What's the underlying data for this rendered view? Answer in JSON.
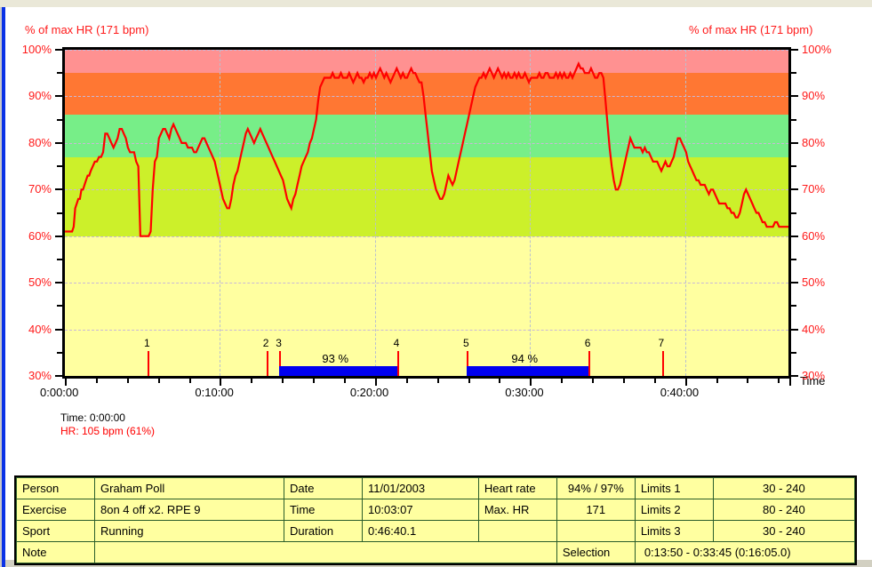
{
  "chart_data": {
    "type": "line",
    "title": "% of max HR (171 bpm)",
    "title_right": "% of max HR (171 bpm)",
    "xlabel": "Time",
    "ylabel": "% of max HR (171 bpm)",
    "ylim": [
      30,
      100
    ],
    "xlim": [
      0,
      2800
    ],
    "grid": true,
    "y_ticks": [
      "30%",
      "40%",
      "50%",
      "60%",
      "70%",
      "80%",
      "90%",
      "100%"
    ],
    "y_tick_values": [
      30,
      40,
      50,
      60,
      70,
      80,
      90,
      100
    ],
    "x_ticks": [
      "0:00:00",
      "0:10:00",
      "0:20:00",
      "0:30:00",
      "0:40:00"
    ],
    "x_tick_seconds": [
      0,
      600,
      1200,
      1800,
      2400
    ],
    "zones": [
      {
        "name": "zone-above-max",
        "from": 100,
        "to": 104,
        "color": "#e0e0e0"
      },
      {
        "name": "zone-5",
        "from": 95,
        "to": 100,
        "color": "#ff9191"
      },
      {
        "name": "zone-4",
        "from": 86,
        "to": 95,
        "color": "#ff7733"
      },
      {
        "name": "zone-3",
        "from": 77,
        "to": 86,
        "color": "#77ee88"
      },
      {
        "name": "zone-2",
        "from": 60,
        "to": 77,
        "color": "#ccf02a"
      },
      {
        "name": "zone-1",
        "from": 30,
        "to": 60,
        "color": "#ffffa0"
      }
    ],
    "series": [
      {
        "name": "Heart rate (% of max)",
        "color": "#ff0000",
        "x": [
          0,
          10,
          20,
          28,
          34,
          40,
          46,
          52,
          58,
          64,
          70,
          76,
          82,
          88,
          94,
          100,
          108,
          116,
          124,
          132,
          140,
          148,
          156,
          164,
          172,
          180,
          188,
          196,
          204,
          212,
          220,
          228,
          236,
          244,
          252,
          260,
          268,
          276,
          284,
          292,
          300,
          308,
          316,
          324,
          332,
          340,
          348,
          356,
          364,
          372,
          380,
          388,
          396,
          404,
          412,
          420,
          428,
          436,
          444,
          452,
          460,
          468,
          476,
          484,
          492,
          500,
          508,
          516,
          524,
          532,
          540,
          548,
          556,
          564,
          572,
          580,
          588,
          596,
          604,
          612,
          620,
          628,
          636,
          644,
          652,
          660,
          668,
          676,
          684,
          692,
          700,
          708,
          716,
          724,
          732,
          740,
          748,
          756,
          764,
          772,
          780,
          788,
          796,
          804,
          812,
          820,
          828,
          836,
          844,
          852,
          860,
          868,
          876,
          884,
          892,
          900,
          908,
          916,
          924,
          932,
          940,
          948,
          956,
          964,
          972,
          980,
          988,
          996,
          1004,
          1012,
          1020,
          1028,
          1036,
          1044,
          1052,
          1060,
          1068,
          1076,
          1084,
          1092,
          1100,
          1108,
          1116,
          1124,
          1132,
          1140,
          1148,
          1156,
          1164,
          1172,
          1180,
          1188,
          1196,
          1204,
          1212,
          1220,
          1228,
          1236,
          1244,
          1252,
          1260,
          1268,
          1276,
          1284,
          1292,
          1300,
          1308,
          1316,
          1324,
          1332,
          1340,
          1348,
          1356,
          1364,
          1372,
          1380,
          1388,
          1396,
          1404,
          1412,
          1420,
          1428,
          1436,
          1444,
          1452,
          1460,
          1468,
          1476,
          1484,
          1492,
          1500,
          1508,
          1516,
          1524,
          1532,
          1540,
          1548,
          1556,
          1564,
          1572,
          1580,
          1588,
          1596,
          1604,
          1612,
          1620,
          1628,
          1636,
          1644,
          1652,
          1660,
          1668,
          1676,
          1684,
          1692,
          1700,
          1708,
          1716,
          1724,
          1732,
          1740,
          1748,
          1756,
          1764,
          1772,
          1780,
          1788,
          1796,
          1804,
          1812,
          1820,
          1828,
          1836,
          1844,
          1852,
          1860,
          1868,
          1876,
          1884,
          1892,
          1900,
          1908,
          1916,
          1924,
          1932,
          1940,
          1948,
          1956,
          1964,
          1972,
          1980,
          1988,
          1996,
          2004,
          2012,
          2020,
          2028,
          2036,
          2044,
          2052,
          2060,
          2068,
          2076,
          2084,
          2092,
          2100,
          2108,
          2116,
          2124,
          2132,
          2140,
          2148,
          2156,
          2164,
          2172,
          2180,
          2188,
          2196,
          2204,
          2212,
          2220,
          2228,
          2236,
          2244,
          2252,
          2260,
          2268,
          2276,
          2284,
          2292,
          2300,
          2308,
          2316,
          2324,
          2332,
          2340,
          2348,
          2356,
          2364,
          2372,
          2380,
          2388,
          2396,
          2404,
          2412,
          2420,
          2428,
          2436,
          2444,
          2452,
          2460,
          2468,
          2476,
          2484,
          2492,
          2500,
          2508,
          2516,
          2524,
          2532,
          2540,
          2548,
          2556,
          2564,
          2572,
          2580,
          2588,
          2596,
          2604,
          2612,
          2620,
          2628,
          2636,
          2644,
          2652,
          2660,
          2668,
          2676,
          2684,
          2692,
          2700,
          2708,
          2716,
          2724,
          2732,
          2740,
          2748,
          2756,
          2764,
          2772,
          2780,
          2790,
          2800
        ],
        "y": [
          61,
          61,
          61,
          61,
          62,
          66,
          67,
          68,
          68,
          70,
          70,
          71,
          72,
          73,
          73,
          74,
          75,
          76,
          76,
          77,
          77,
          78,
          82,
          82,
          81,
          80,
          79,
          80,
          81,
          83,
          83,
          82,
          81,
          79,
          78,
          78,
          78,
          76,
          75,
          60,
          60,
          60,
          60,
          60,
          61,
          70,
          76,
          77,
          81,
          82,
          83,
          83,
          82,
          81,
          83,
          84,
          83,
          82,
          81,
          80,
          80,
          80,
          79,
          79,
          79,
          78,
          78,
          79,
          80,
          81,
          81,
          80,
          79,
          78,
          77,
          76,
          74,
          72,
          70,
          68,
          67,
          66,
          66,
          68,
          71,
          73,
          74,
          76,
          78,
          80,
          82,
          83,
          82,
          81,
          80,
          81,
          82,
          83,
          82,
          81,
          80,
          79,
          78,
          77,
          76,
          75,
          74,
          73,
          72,
          70,
          68,
          67,
          66,
          68,
          69,
          71,
          73,
          75,
          76,
          77,
          78,
          80,
          81,
          83,
          85,
          89,
          92,
          93,
          94,
          94,
          94,
          94,
          95,
          94,
          94,
          94,
          95,
          94,
          94,
          94,
          95,
          94,
          93,
          94,
          95,
          94,
          94,
          93,
          94,
          94,
          95,
          94,
          95,
          94,
          95,
          96,
          95,
          94,
          95,
          94,
          93,
          94,
          95,
          96,
          95,
          94,
          95,
          94,
          94,
          95,
          96,
          95,
          95,
          94,
          93,
          93,
          90,
          86,
          82,
          78,
          74,
          72,
          70,
          69,
          68,
          68,
          69,
          71,
          73,
          72,
          71,
          72,
          74,
          76,
          78,
          80,
          82,
          84,
          86,
          88,
          90,
          92,
          93,
          94,
          94,
          95,
          94,
          95,
          96,
          95,
          94,
          95,
          96,
          95,
          94,
          95,
          94,
          95,
          94,
          94,
          95,
          94,
          95,
          94,
          94,
          95,
          94,
          93,
          94,
          94,
          94,
          94,
          95,
          94,
          94,
          95,
          95,
          94,
          94,
          94,
          95,
          94,
          95,
          94,
          95,
          94,
          94,
          95,
          94,
          95,
          96,
          97,
          96,
          96,
          95,
          95,
          95,
          96,
          95,
          94,
          94,
          95,
          95,
          94,
          89,
          84,
          79,
          75,
          72,
          70,
          70,
          71,
          73,
          75,
          77,
          79,
          81,
          80,
          79,
          79,
          79,
          79,
          78,
          79,
          78,
          78,
          77,
          76,
          76,
          76,
          75,
          74,
          75,
          76,
          75,
          75,
          76,
          77,
          79,
          81,
          81,
          80,
          79,
          78,
          76,
          75,
          74,
          73,
          72,
          72,
          71,
          71,
          71,
          70,
          69,
          70,
          70,
          69,
          68,
          67,
          67,
          67,
          67,
          66,
          66,
          65,
          65,
          64,
          64,
          65,
          67,
          69,
          70,
          69,
          68,
          67,
          66,
          65,
          65,
          64,
          63,
          63,
          62,
          62,
          62,
          62,
          63,
          63,
          62,
          62,
          62,
          62,
          62,
          62,
          62,
          62,
          63,
          63,
          62,
          62,
          62,
          62
        ]
      }
    ],
    "lap_markers": [
      {
        "label": "1",
        "seconds": 320
      },
      {
        "label": "2",
        "seconds": 780
      },
      {
        "label": "3",
        "seconds": 830
      },
      {
        "label": "4",
        "seconds": 1285
      },
      {
        "label": "5",
        "seconds": 1555
      },
      {
        "label": "6",
        "seconds": 2025
      },
      {
        "label": "7",
        "seconds": 2310
      }
    ],
    "selection_bars": [
      {
        "label": "93 %",
        "from_seconds": 830,
        "to_seconds": 1285
      },
      {
        "label": "94 %",
        "from_seconds": 1555,
        "to_seconds": 2025
      }
    ],
    "readout": {
      "time_label": "Time: 0:00:00",
      "hr_label": "HR: 105 bpm (61%)"
    },
    "colors": {
      "trace": "#ff0000",
      "axis_text": "#ff1a1a",
      "selection_bar": "#0000f0",
      "lap_marker": "#ff0000"
    }
  },
  "info_table": {
    "rows": [
      {
        "cells": [
          {
            "kind": "label",
            "text": "Person"
          },
          {
            "kind": "value",
            "text": "Graham Poll"
          },
          {
            "kind": "label",
            "text": "Date"
          },
          {
            "kind": "value",
            "text": "11/01/2003"
          },
          {
            "kind": "label",
            "text": "Heart rate"
          },
          {
            "kind": "value-c",
            "text": "94% / 97%"
          },
          {
            "kind": "label",
            "text": "Limits 1"
          },
          {
            "kind": "value-c",
            "text": "30 - 240"
          }
        ]
      },
      {
        "cells": [
          {
            "kind": "label",
            "text": "Exercise"
          },
          {
            "kind": "value",
            "text": "8on 4 off x2. RPE 9"
          },
          {
            "kind": "label",
            "text": "Time"
          },
          {
            "kind": "value",
            "text": "10:03:07"
          },
          {
            "kind": "label",
            "text": "Max. HR"
          },
          {
            "kind": "value-c",
            "text": "171"
          },
          {
            "kind": "label",
            "text": "Limits 2"
          },
          {
            "kind": "value-c",
            "text": "80 - 240"
          }
        ]
      },
      {
        "cells": [
          {
            "kind": "label",
            "text": "Sport"
          },
          {
            "kind": "value",
            "text": "Running"
          },
          {
            "kind": "label",
            "text": "Duration"
          },
          {
            "kind": "value",
            "text": "0:46:40.1"
          },
          {
            "kind": "label-blank",
            "text": ""
          },
          {
            "kind": "value-c",
            "text": ""
          },
          {
            "kind": "label",
            "text": "Limits 3"
          },
          {
            "kind": "value-c",
            "text": "30 - 240"
          }
        ]
      },
      {
        "cells": [
          {
            "kind": "label",
            "text": "Note"
          },
          {
            "kind": "value-span4",
            "text": ""
          },
          {
            "kind": "label",
            "text": "Selection"
          },
          {
            "kind": "value-span3",
            "text": "0:13:50 - 0:33:45 (0:16:05.0)"
          }
        ]
      }
    ]
  }
}
